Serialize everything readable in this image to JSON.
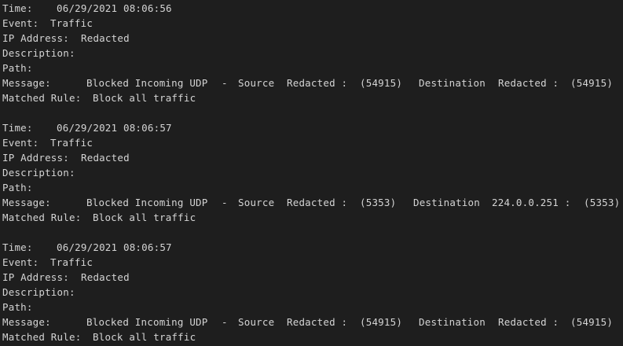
{
  "labels": {
    "time": "Time:",
    "event": "Event:",
    "ip": "IP Address:",
    "description": "Description:",
    "path": "Path:",
    "message": "Message:",
    "matched_rule": "Matched Rule:"
  },
  "colors": {
    "background": "#1e1e1e",
    "text": "#d4d4d4"
  },
  "records": [
    {
      "time": "06/29/2021 08:06:56",
      "event": "Traffic",
      "ip_address": "Redacted",
      "description": "",
      "path": "",
      "message": {
        "action": "Blocked Incoming UDP",
        "dash": "-",
        "source_label": "Source",
        "source_addr": "Redacted :",
        "source_port": "(54915)",
        "destination_label": "Destination",
        "destination_addr": "Redacted :",
        "destination_port": "(54915)"
      },
      "matched_rule": "Block all traffic"
    },
    {
      "time": "06/29/2021 08:06:57",
      "event": "Traffic",
      "ip_address": "Redacted",
      "description": "",
      "path": "",
      "message": {
        "action": "Blocked Incoming UDP",
        "dash": "-",
        "source_label": "Source",
        "source_addr": "Redacted :",
        "source_port": "(5353)",
        "destination_label": "Destination",
        "destination_addr": "224.0.0.251 :",
        "destination_port": "(5353)"
      },
      "matched_rule": "Block all traffic"
    },
    {
      "time": "06/29/2021 08:06:57",
      "event": "Traffic",
      "ip_address": "Redacted",
      "description": "",
      "path": "",
      "message": {
        "action": "Blocked Incoming UDP",
        "dash": "-",
        "source_label": "Source",
        "source_addr": "Redacted :",
        "source_port": "(54915)",
        "destination_label": "Destination",
        "destination_addr": "Redacted :",
        "destination_port": "(54915)"
      },
      "matched_rule": "Block all traffic"
    }
  ]
}
